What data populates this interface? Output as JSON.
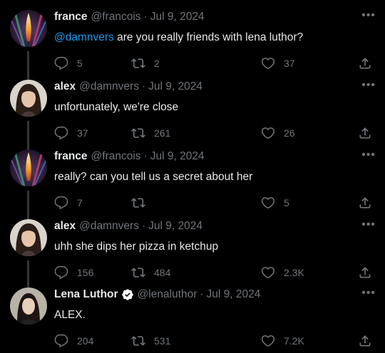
{
  "colors": {
    "background": "#000000",
    "primary_text": "#e7e9ea",
    "secondary_text": "#71767b",
    "link": "#1d9bf0",
    "verified_badge": "#ffffff",
    "thread_line": "#333639"
  },
  "tweets": [
    {
      "name": "france",
      "handle": "@francois",
      "separator": "·",
      "date": "Jul 9, 2024",
      "mention": "@damnvers",
      "text": " are you really friends with lena luthor?",
      "replies": "5",
      "retweets": "2",
      "likes": "37",
      "verified": false,
      "avatar": "candle-flame-avatar"
    },
    {
      "name": "alex",
      "handle": "@damnvers",
      "separator": "·",
      "date": "Jul 9, 2024",
      "mention": "",
      "text": "unfortunately, we're close",
      "replies": "37",
      "retweets": "261",
      "likes": "26",
      "verified": false,
      "avatar": "dark-haired-woman-avatar"
    },
    {
      "name": "france",
      "handle": "@francois",
      "separator": "·",
      "date": "Jul 9, 2024",
      "mention": "",
      "text": "really? can you tell us a secret about her",
      "replies": "7",
      "retweets": "",
      "likes": "5",
      "verified": false,
      "avatar": "candle-flame-avatar"
    },
    {
      "name": "alex",
      "handle": "@damnvers",
      "separator": "·",
      "date": "Jul 9, 2024",
      "mention": "",
      "text": "uhh she dips her pizza in ketchup",
      "replies": "156",
      "retweets": "484",
      "likes": "2.3K",
      "verified": false,
      "avatar": "dark-haired-woman-avatar"
    },
    {
      "name": "Lena Luthor",
      "handle": "@lenaluthor",
      "separator": "·",
      "date": "Jul 9, 2024",
      "mention": "",
      "text": "ALEX.",
      "replies": "204",
      "retweets": "531",
      "likes": "7.2K",
      "verified": true,
      "avatar": "lena-avatar"
    }
  ]
}
